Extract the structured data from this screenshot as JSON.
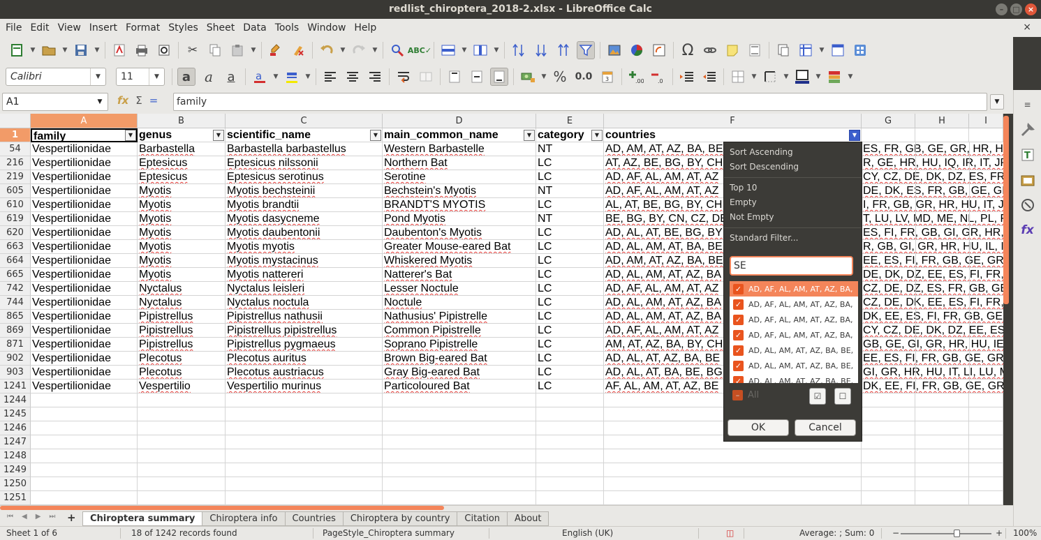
{
  "window": {
    "title": "redlist_chiroptera_2018-2.xlsx - LibreOffice Calc",
    "minimize": "–",
    "maximize": "□",
    "close": "×"
  },
  "menu": {
    "items": [
      "File",
      "Edit",
      "View",
      "Insert",
      "Format",
      "Styles",
      "Sheet",
      "Data",
      "Tools",
      "Window",
      "Help"
    ],
    "close_doc": "×"
  },
  "toolbar2": {
    "font_name": "Calibri",
    "font_size": "11",
    "percent": "%",
    "decimal": "0.0"
  },
  "formula": {
    "cell_ref": "A1",
    "content": "family"
  },
  "columns": [
    {
      "letter": "A"
    },
    {
      "letter": "B"
    },
    {
      "letter": "C"
    },
    {
      "letter": "D"
    },
    {
      "letter": "E"
    },
    {
      "letter": "F"
    },
    {
      "letter": "G"
    },
    {
      "letter": "H"
    },
    {
      "letter": "I"
    }
  ],
  "header_row": {
    "number": "1",
    "cells": [
      "family",
      "genus",
      "scientific_name",
      "main_common_name",
      "category",
      "countries"
    ]
  },
  "rows": [
    {
      "n": "54",
      "c": [
        "Vespertilionidae",
        "Barbastella",
        "Barbastella barbastellus",
        "Western Barbastelle",
        "NT",
        "AD, AM, AT, AZ, BA, BE",
        "ES, FR, GB, GE, GR, HR, HU"
      ]
    },
    {
      "n": "216",
      "c": [
        "Vespertilionidae",
        "Eptesicus",
        "Eptesicus nilssonii",
        "Northern Bat",
        "LC",
        "AT, AZ, BE, BG, BY, CH",
        "R, GE, HR, HU, IQ, IR, IT, JP,"
      ]
    },
    {
      "n": "219",
      "c": [
        "Vespertilionidae",
        "Eptesicus",
        "Eptesicus serotinus",
        "Serotine",
        "LC",
        "AD, AF, AL, AM, AT, AZ",
        "CY, CZ, DE, DK, DZ, ES, FR,"
      ]
    },
    {
      "n": "605",
      "c": [
        "Vespertilionidae",
        "Myotis",
        "Myotis bechsteinii",
        "Bechstein's Myotis",
        "NT",
        "AD, AF, AL, AM, AT, AZ",
        "DE, DK, ES, FR, GB, GE, GI,"
      ]
    },
    {
      "n": "610",
      "c": [
        "Vespertilionidae",
        "Myotis",
        "Myotis brandtii",
        "BRANDT'S MYOTIS",
        "LC",
        "AL, AT, BE, BG, BY, CH",
        "I, FR, GB, GR, HR, HU, IT, JP"
      ]
    },
    {
      "n": "619",
      "c": [
        "Vespertilionidae",
        "Myotis",
        "Myotis dasycneme",
        "Pond Myotis",
        "NT",
        "BE, BG, BY, CN, CZ, DE",
        "T, LU, LV, MD, ME, NL, PL, F"
      ]
    },
    {
      "n": "620",
      "c": [
        "Vespertilionidae",
        "Myotis",
        "Myotis daubentonii",
        "Daubenton's Myotis",
        "LC",
        "AD, AL, AT, BE, BG, BY",
        "ES, FI, FR, GB, GI, GR, HR, H"
      ]
    },
    {
      "n": "663",
      "c": [
        "Vespertilionidae",
        "Myotis",
        "Myotis myotis",
        "Greater Mouse-eared Bat",
        "LC",
        "AD, AL, AM, AT, BA, BE, BG",
        "R, GB, GI, GR, HR, HU, IL, IT"
      ]
    },
    {
      "n": "664",
      "c": [
        "Vespertilionidae",
        "Myotis",
        "Myotis mystacinus",
        "Whiskered Myotis",
        "LC",
        "AD, AM, AT, AZ, BA, BE",
        "EE, ES, FI, FR, GB, GE, GR,"
      ]
    },
    {
      "n": "665",
      "c": [
        "Vespertilionidae",
        "Myotis",
        "Myotis nattereri",
        "Natterer's Bat",
        "LC",
        "AD, AL, AM, AT, AZ, BA",
        "DE, DK, DZ, EE, ES, FI, FR, C"
      ]
    },
    {
      "n": "742",
      "c": [
        "Vespertilionidae",
        "Nyctalus",
        "Nyctalus leisleri",
        "Lesser Noctule",
        "LC",
        "AD, AF, AL, AM, AT, AZ",
        "CZ, DE, DZ, ES, FR, GB, GE"
      ]
    },
    {
      "n": "744",
      "c": [
        "Vespertilionidae",
        "Nyctalus",
        "Nyctalus noctula",
        "Noctule",
        "LC",
        "AD, AL, AM, AT, AZ, BA",
        "CZ, DE, DK, EE, ES, FI, FR, C"
      ]
    },
    {
      "n": "865",
      "c": [
        "Vespertilionidae",
        "Pipistrellus",
        "Pipistrellus nathusii",
        "Nathusius' Pipistrelle",
        "LC",
        "AD, AL, AM, AT, AZ, BA",
        "DK, EE, ES, FI, FR, GB, GE,"
      ]
    },
    {
      "n": "869",
      "c": [
        "Vespertilionidae",
        "Pipistrellus",
        "Pipistrellus pipistrellus",
        "Common Pipistrelle",
        "LC",
        "AD, AF, AL, AM, AT, AZ",
        "CY, CZ, DE, DK, DZ, EE, ES,"
      ]
    },
    {
      "n": "871",
      "c": [
        "Vespertilionidae",
        "Pipistrellus",
        "Pipistrellus pygmaeus",
        "Soprano Pipistrelle",
        "LC",
        "AM, AT, AZ, BA, BY, CH",
        "GB, GE, GI, GR, HR, HU, IE,"
      ]
    },
    {
      "n": "902",
      "c": [
        "Vespertilionidae",
        "Plecotus",
        "Plecotus auritus",
        "Brown Big-eared Bat",
        "LC",
        "AD, AL, AT, AZ, BA, BE",
        "EE, ES, FI, FR, GB, GE, GR, I"
      ]
    },
    {
      "n": "903",
      "c": [
        "Vespertilionidae",
        "Plecotus",
        "Plecotus austriacus",
        "Gray Big-eared Bat",
        "LC",
        "AD, AL, AT, BA, BE, BG",
        "GI, GR, HR, HU, IT, LI, LU, M"
      ]
    },
    {
      "n": "1241",
      "c": [
        "Vespertilionidae",
        "Vespertilio",
        "Vespertilio murinus",
        "Particoloured Bat",
        "LC",
        "AF, AL, AM, AT, AZ, BE",
        "DK, EE, FI, FR, GB, GE, GR,"
      ]
    }
  ],
  "empty_rows": [
    "1244",
    "1245",
    "1246",
    "1247",
    "1248",
    "1249",
    "1250",
    "1251"
  ],
  "filter_popup": {
    "sort_asc": "Sort Ascending",
    "sort_desc": "Sort Descending",
    "top10": "Top 10",
    "empty": "Empty",
    "not_empty": "Not Empty",
    "standard_filter": "Standard Filter...",
    "search_value": "SE",
    "items": [
      "AD, AF, AL, AM, AT, AZ, BA,",
      "AD, AF, AL, AM, AT, AZ, BA,",
      "AD, AF, AL, AM, AT, AZ, BA,",
      "AD, AF, AL, AM, AT, AZ, BA,",
      "AD, AL, AM, AT, AZ, BA, BE,",
      "AD, AL, AM, AT, AZ, BA, BE,",
      "AD, AL, AM, AT, AZ, BA, BE,"
    ],
    "all_label": "All",
    "ok": "OK",
    "cancel": "Cancel"
  },
  "sheets": {
    "tabs": [
      "Chiroptera summary",
      "Chiroptera info",
      "Countries",
      "Chiroptera by country",
      "Citation",
      "About"
    ],
    "active": "Chiroptera summary",
    "add": "+"
  },
  "status": {
    "sheet": "Sheet 1 of 6",
    "records": "18 of 1242 records found",
    "page_style": "PageStyle_Chiroptera summary",
    "language": "English (UK)",
    "sum": "Average: ; Sum: 0",
    "zoom": "100%",
    "zoom_minus": "−",
    "zoom_plus": "+"
  },
  "colors": {
    "accent": "#f4855a",
    "filter_active": "#3b5ecc",
    "checkbox": "#e9541e",
    "popup_bg": "#3c3b37"
  }
}
